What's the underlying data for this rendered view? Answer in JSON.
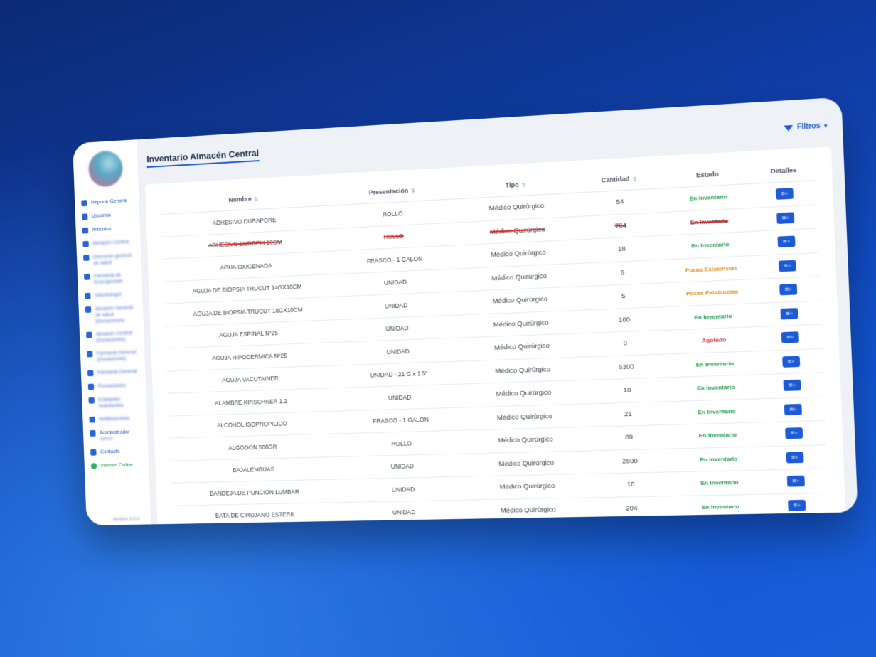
{
  "app": {
    "page_title": "Inventario Almacén Central",
    "filters_label": "Filtros",
    "version": "Versión 3.0.0"
  },
  "sidebar": {
    "items": [
      {
        "label": "Reporte General",
        "icon": "document-icon"
      },
      {
        "label": "Usuarios",
        "icon": "users-icon"
      },
      {
        "label": "Artículos",
        "icon": "box-icon"
      },
      {
        "label": "Almacén Central",
        "icon": "building-icon"
      },
      {
        "label": "Dirección general de salud",
        "icon": "building-icon"
      },
      {
        "label": "Farmacia de Emergencias",
        "icon": "building-icon"
      },
      {
        "label": "Odontología",
        "icon": "calendar-icon"
      },
      {
        "label": "Almacén General de salud (Donaciones)",
        "icon": "building-icon"
      },
      {
        "label": "Almacén Central (Donaciones)",
        "icon": "building-icon"
      },
      {
        "label": "Farmacia General (Donaciones)",
        "icon": "building-icon"
      },
      {
        "label": "Farmacia General",
        "icon": "building-icon"
      },
      {
        "label": "Proveedores",
        "icon": "store-icon"
      },
      {
        "label": "Entidades Solicitantes",
        "icon": "building-icon"
      },
      {
        "label": "Notificaciones",
        "icon": "bell-icon"
      },
      {
        "label": "Administrador",
        "sub": "admin",
        "icon": "user-icon"
      },
      {
        "label": "Contacto",
        "icon": "phone-icon"
      },
      {
        "label": "Internet Online",
        "icon": "wifi-icon"
      }
    ]
  },
  "table": {
    "headers": [
      "Nombre",
      "Presentación",
      "Tipo",
      "Cantidad",
      "Estado",
      "Detalles"
    ],
    "rows": [
      {
        "nombre": "ADHESIVO DURAPORE",
        "presentacion": "ROLLO",
        "tipo": "Médico Quirúrgico",
        "cantidad": "54",
        "estado": "En Inventario",
        "status": "ok"
      },
      {
        "nombre": "ADHESIVO EUROFIX 10CM",
        "presentacion": "ROLLO",
        "tipo": "Médico Quirúrgico",
        "cantidad": "764",
        "estado": "En Inventario",
        "status": "struck"
      },
      {
        "nombre": "AGUA OXIGENADA",
        "presentacion": "FRASCO - 1 GALON",
        "tipo": "Médico Quirúrgico",
        "cantidad": "18",
        "estado": "En Inventario",
        "status": "ok"
      },
      {
        "nombre": "AGUJA DE BIOPSIA TRUCUT 14GX10CM",
        "presentacion": "UNIDAD",
        "tipo": "Médico Quirúrgico",
        "cantidad": "5",
        "estado": "Pocas Existencias",
        "status": "low"
      },
      {
        "nombre": "AGUJA DE BIOPSIA TRUCUT 18GX10CM",
        "presentacion": "UNIDAD",
        "tipo": "Médico Quirúrgico",
        "cantidad": "5",
        "estado": "Pocas Existencias",
        "status": "low"
      },
      {
        "nombre": "AGUJA ESPINAL Nº25",
        "presentacion": "UNIDAD",
        "tipo": "Médico Quirúrgico",
        "cantidad": "100",
        "estado": "En Inventario",
        "status": "ok"
      },
      {
        "nombre": "AGUJA HIPODERMICA Nº25",
        "presentacion": "UNIDAD",
        "tipo": "Médico Quirúrgico",
        "cantidad": "0",
        "estado": "Agotado",
        "status": "out"
      },
      {
        "nombre": "AGUJA VACUTAINER",
        "presentacion": "UNIDAD - 21 G x 1.5\"",
        "tipo": "Médico Quirúrgico",
        "cantidad": "6300",
        "estado": "En Inventario",
        "status": "ok"
      },
      {
        "nombre": "ALAMBRE KIRSCHNER 1.2",
        "presentacion": "UNIDAD",
        "tipo": "Médico Quirúrgico",
        "cantidad": "10",
        "estado": "En Inventario",
        "status": "ok"
      },
      {
        "nombre": "ALCOHOL ISOPROPILICO",
        "presentacion": "FRASCO - 1 GALON",
        "tipo": "Médico Quirúrgico",
        "cantidad": "21",
        "estado": "En Inventario",
        "status": "ok"
      },
      {
        "nombre": "ALGODÓN 500GR",
        "presentacion": "ROLLO",
        "tipo": "Médico Quirúrgico",
        "cantidad": "89",
        "estado": "En Inventario",
        "status": "ok"
      },
      {
        "nombre": "BAJALENGUAS",
        "presentacion": "UNIDAD",
        "tipo": "Médico Quirúrgico",
        "cantidad": "2600",
        "estado": "En Inventario",
        "status": "ok"
      },
      {
        "nombre": "BANDEJA DE PUNCION LUMBAR",
        "presentacion": "UNIDAD",
        "tipo": "Médico Quirúrgico",
        "cantidad": "10",
        "estado": "En Inventario",
        "status": "ok"
      },
      {
        "nombre": "BATA DE CIRUJANO ESTERIL",
        "presentacion": "UNIDAD",
        "tipo": "Médico Quirúrgico",
        "cantidad": "204",
        "estado": "En Inventario",
        "status": "ok"
      }
    ],
    "details_icon": "details-search-icon"
  },
  "colors": {
    "accent": "#1d5ad6",
    "ok": "#1e9e4a",
    "low": "#e38a1c",
    "out": "#d93636"
  }
}
